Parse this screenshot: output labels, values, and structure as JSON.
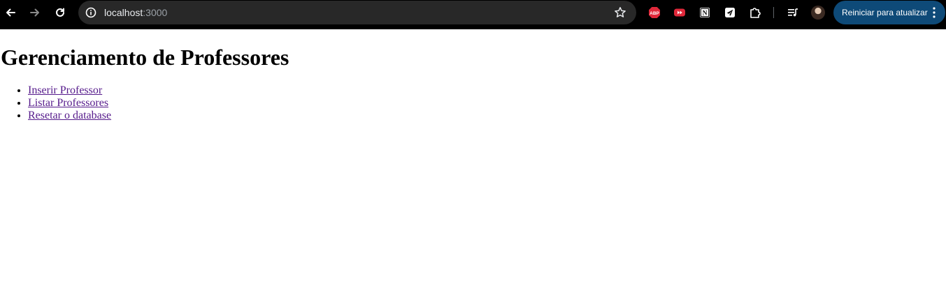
{
  "browser": {
    "url_host": "localhost",
    "url_port": ":3000",
    "update_button_label": "Reiniciar para atualizar",
    "icons": {
      "back": "arrow-left-icon",
      "forward": "arrow-right-icon",
      "reload": "reload-icon",
      "site_info": "info-icon",
      "bookmark": "star-icon",
      "extensions": [
        "adblock-plus-icon",
        "youtube-extension-icon",
        "notion-icon",
        "telegram-extension-icon",
        "puzzle-icon"
      ],
      "media": "media-queue-icon",
      "menu": "kebab-menu-icon"
    },
    "extension_labels": {
      "adblock": "ABP",
      "notion": "N"
    },
    "colors": {
      "toolbar_bg": "#000000",
      "omnibox_bg": "#282828",
      "update_button_bg": "#0e4a78"
    }
  },
  "page": {
    "title": "Gerenciamento de Professores",
    "links": [
      {
        "label": "Inserir Professor"
      },
      {
        "label": "Listar Professores"
      },
      {
        "label": "Resetar o database"
      }
    ],
    "link_color": "#551a8b"
  }
}
